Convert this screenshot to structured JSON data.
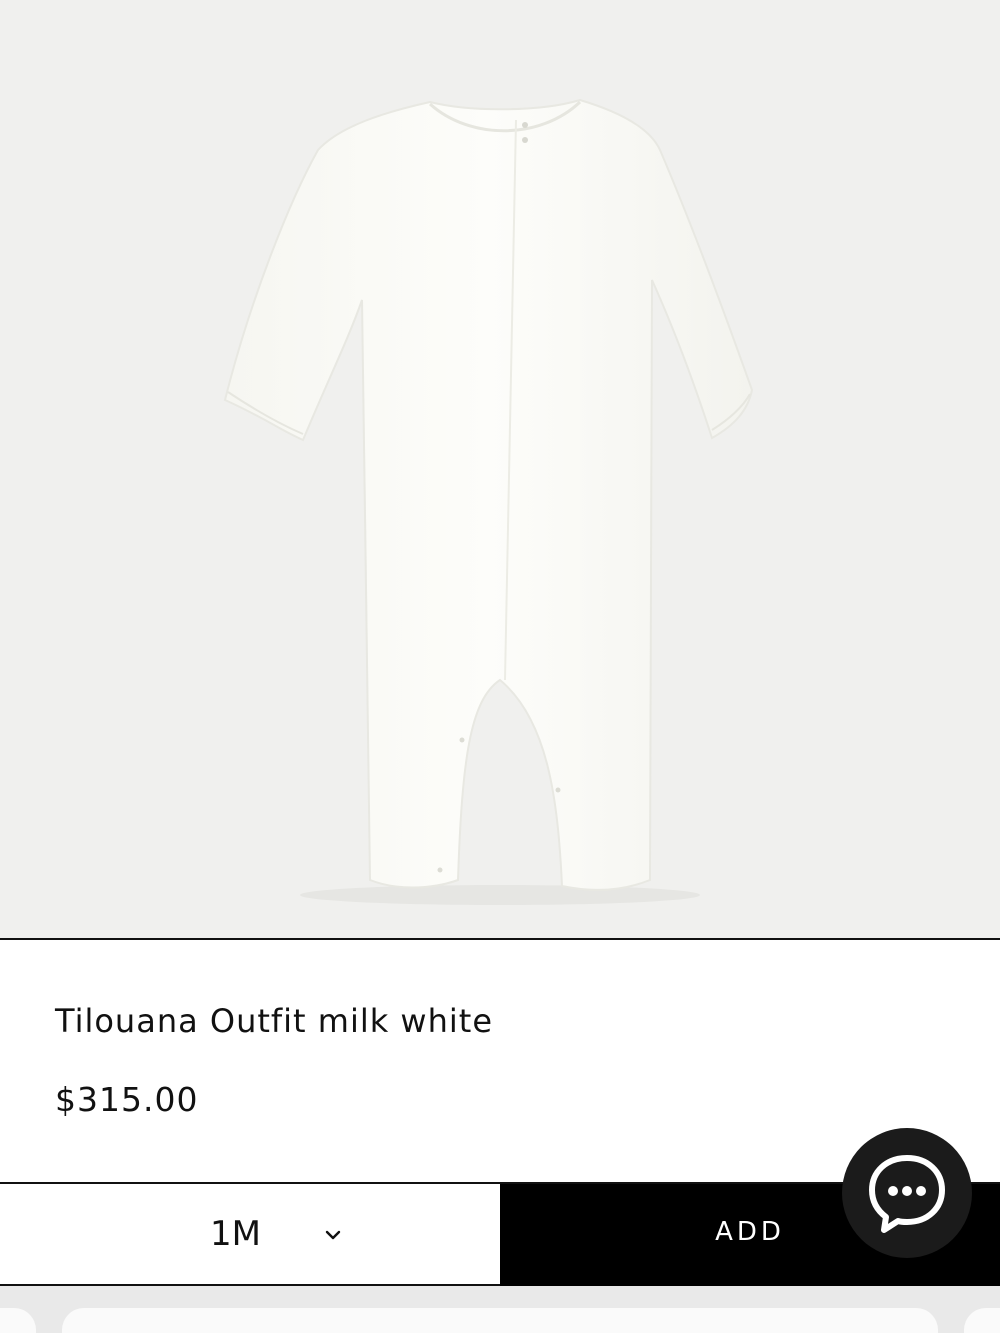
{
  "product": {
    "image_icon": "romper-product-photo",
    "title": "Tilouana Outfit milk white",
    "price": "$315.00"
  },
  "purchase": {
    "size_selected": "1M",
    "add_label": "ADD"
  },
  "chat": {
    "icon": "chat-bubble-icon"
  },
  "colors": {
    "image_background": "#f0f0ee",
    "garment": "#fbfbf7",
    "add_button_bg": "#000000",
    "chat_button_bg": "#1b1b1b"
  }
}
